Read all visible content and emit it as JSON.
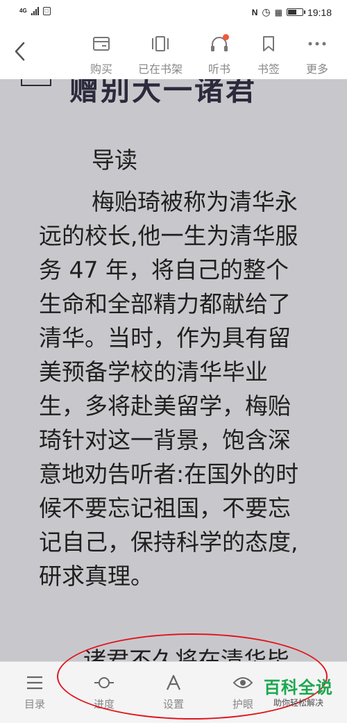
{
  "status_bar": {
    "network": "4G",
    "time": "19:18"
  },
  "toolbar": {
    "items": [
      {
        "label": "购买",
        "icon": "wallet-icon"
      },
      {
        "label": "已在书架",
        "icon": "bookshelf-icon"
      },
      {
        "label": "听书",
        "icon": "headphones-icon"
      },
      {
        "label": "书签",
        "icon": "bookmark-icon"
      },
      {
        "label": "更多",
        "icon": "more-icon"
      }
    ]
  },
  "content": {
    "chapter_heading": "赠别大一诸君",
    "subtitle": "导读",
    "body": "梅贻琦被称为清华永远的校长,他一生为清华服务 47 年，将自己的整个生命和全部精力都献给了清华。当时，作为具有留美预备学校的清华毕业生，多将赴美留学，梅贻琦针对这一背景，饱含深意地劝告听者:在国外的时候不要忘记祖国，不要忘记自己，保持科学的态度,研求真理。",
    "next_line": "诸君不久将在清华毕"
  },
  "bottom_bar": {
    "items": [
      {
        "label": "目录",
        "icon": "menu-icon"
      },
      {
        "label": "进度",
        "icon": "progress-icon"
      },
      {
        "label": "设置",
        "icon": "font-settings-icon"
      },
      {
        "label": "护眼",
        "icon": "eye-icon"
      }
    ]
  },
  "watermark": {
    "main": "百科全说",
    "sub": "助你轻松解决"
  },
  "colors": {
    "reading_background": "#c8c8cc",
    "toolbar_background": "#ffffff",
    "notification_dot": "#f05a3c",
    "annotation_circle": "#e0161e",
    "watermark_green": "#1aa84e"
  }
}
